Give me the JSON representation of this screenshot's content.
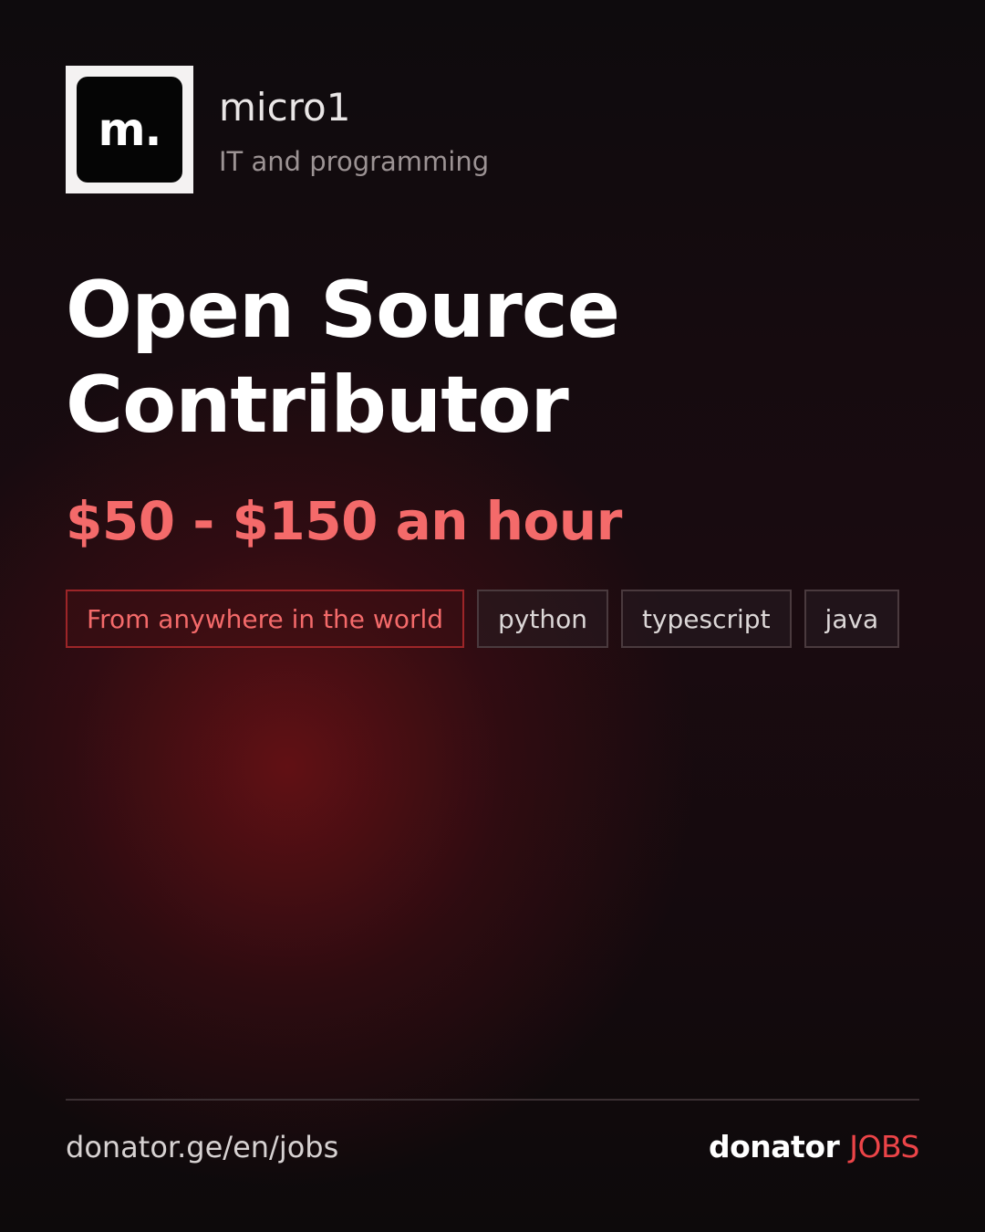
{
  "company": {
    "logo_text": "m.",
    "name": "micro1",
    "category": "IT and programming"
  },
  "job": {
    "title": "Open Source Contributor",
    "salary": "$50 - $150 an hour",
    "location_tag": "From anywhere in the world",
    "skill_tags": [
      "python",
      "typescript",
      "java"
    ]
  },
  "footer": {
    "url": "donator.ge/en/jobs",
    "brand_name": "donator",
    "brand_suffix": "JOBS"
  },
  "colors": {
    "accent": "#f46a6a",
    "brand_accent": "#ec4448",
    "background": "#0e0b0d"
  }
}
